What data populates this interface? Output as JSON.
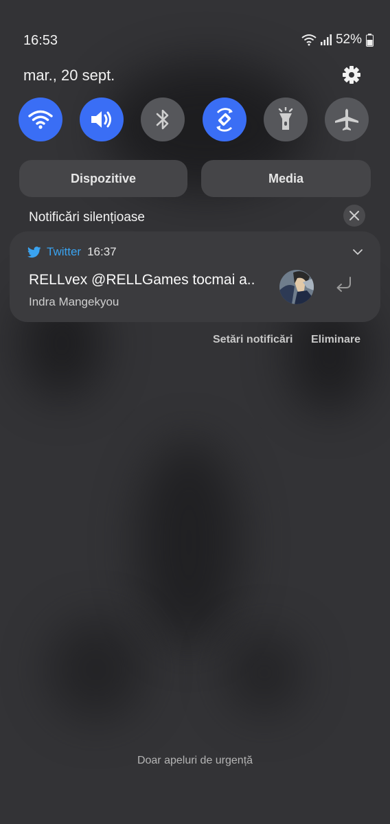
{
  "status_bar": {
    "time": "16:53",
    "battery": "52%"
  },
  "header": {
    "date": "mar., 20 sept."
  },
  "quick_settings": [
    {
      "name": "wifi",
      "icon": "wifi-icon",
      "active": true
    },
    {
      "name": "sound",
      "icon": "volume-icon",
      "active": true
    },
    {
      "name": "bluetooth",
      "icon": "bluetooth-icon",
      "active": false
    },
    {
      "name": "auto-rotate",
      "icon": "rotate-icon",
      "active": true
    },
    {
      "name": "flashlight",
      "icon": "flashlight-icon",
      "active": false
    },
    {
      "name": "airplane-mode",
      "icon": "airplane-icon",
      "active": false
    }
  ],
  "buttons": {
    "devices": "Dispozitive",
    "media": "Media"
  },
  "silent_section": {
    "title": "Notificări silențioase"
  },
  "notification": {
    "app": "Twitter",
    "time": "16:37",
    "title": "RELLvex @RELLGames tocmai a..",
    "subtitle": "Indra Mangekyou"
  },
  "actions": {
    "settings": "Setări notificări",
    "clear": "Eliminare"
  },
  "footer": "Doar apeluri de urgență",
  "colors": {
    "accent": "#3a6ef5",
    "twitter": "#3aa3f0",
    "background": "#333336"
  }
}
